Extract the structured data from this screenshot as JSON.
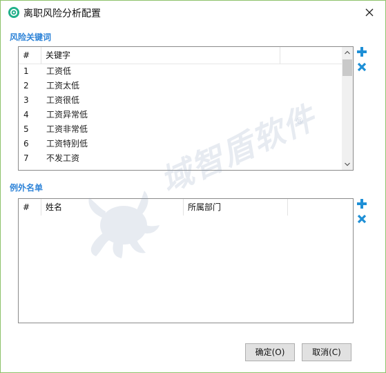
{
  "window": {
    "title": "离职风险分析配置"
  },
  "risk_section": {
    "label": "风险关键词",
    "columns": [
      "#",
      "关键字"
    ],
    "rows": [
      {
        "num": "1",
        "keyword": "工资低"
      },
      {
        "num": "2",
        "keyword": "工资太低"
      },
      {
        "num": "3",
        "keyword": "工资很低"
      },
      {
        "num": "4",
        "keyword": "工资异常低"
      },
      {
        "num": "5",
        "keyword": "工资非常低"
      },
      {
        "num": "6",
        "keyword": "工资特别低"
      },
      {
        "num": "7",
        "keyword": "不发工资"
      }
    ]
  },
  "exception_section": {
    "label": "例外名单",
    "columns": [
      "#",
      "姓名",
      "所属部门"
    ]
  },
  "buttons": {
    "ok": "确定(O)",
    "cancel": "取消(C)"
  },
  "watermark": {
    "text": "域智盾软件",
    "registered": "®"
  },
  "colors": {
    "accent": "#2f84d8",
    "border": "#8cc26a",
    "app_icon": "#21b08a"
  }
}
